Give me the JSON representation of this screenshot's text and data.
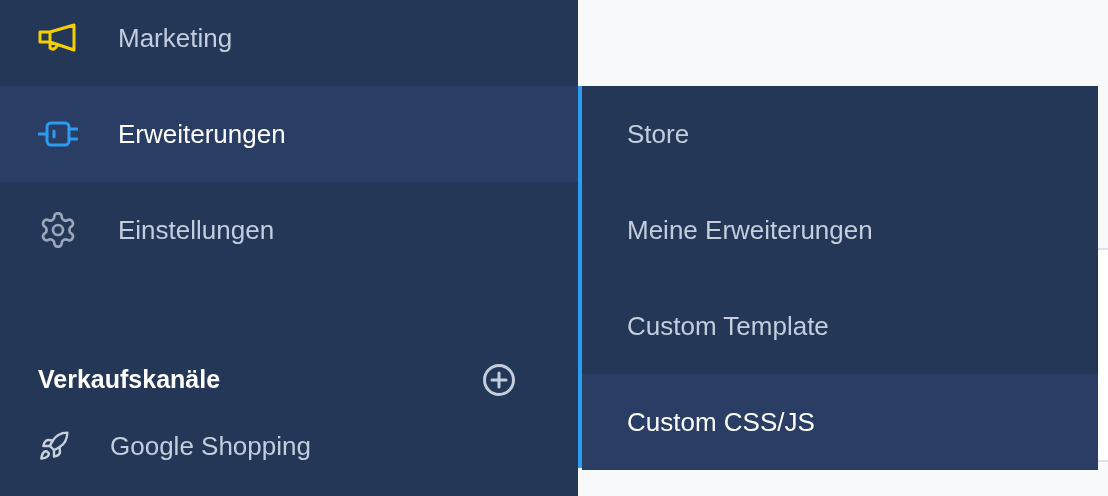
{
  "sidebar": {
    "items": [
      {
        "label": "Marketing",
        "selected": false
      },
      {
        "label": "Erweiterungen",
        "selected": true
      },
      {
        "label": "Einstellungen",
        "selected": false
      }
    ]
  },
  "sales_channels": {
    "title": "Verkaufskanäle",
    "items": [
      {
        "label": "Google Shopping"
      }
    ]
  },
  "flyout": {
    "items": [
      {
        "label": "Store",
        "selected": false
      },
      {
        "label": "Meine Erweiterungen",
        "selected": false
      },
      {
        "label": "Custom Template",
        "selected": false
      },
      {
        "label": "Custom CSS/JS",
        "selected": true
      }
    ]
  }
}
